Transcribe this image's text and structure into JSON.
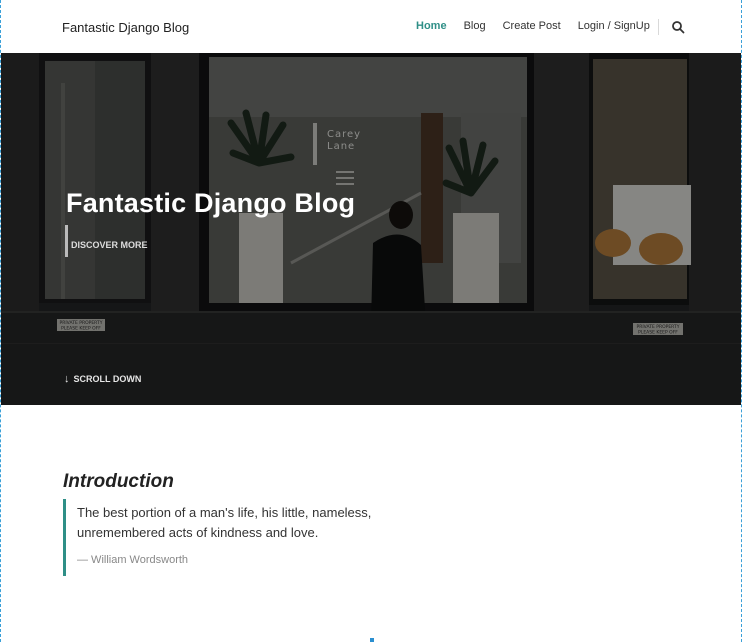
{
  "navbar": {
    "brand": "Fantastic Django Blog",
    "links": [
      {
        "label": "Home",
        "active": true
      },
      {
        "label": "Blog",
        "active": false
      },
      {
        "label": "Create Post",
        "active": false
      },
      {
        "label": "Login / SignUp",
        "active": false
      }
    ],
    "search_icon": "search-icon",
    "accent_color": "#2f8f87"
  },
  "hero": {
    "title": "Fantastic Django Blog",
    "discover_label": "DISCOVER MORE",
    "scroll_label": "SCROLL DOWN",
    "sign_line1": "Carey",
    "sign_line2": "Lane",
    "plaque_left_1": "PRIVATE PROPERTY",
    "plaque_left_2": "PLEASE KEEP OFF",
    "plaque_right_1": "PRIVATE PROPERTY",
    "plaque_right_2": "PLEASE KEEP OFF"
  },
  "intro": {
    "heading": "Introduction",
    "quote": "The best portion of a man's life, his little, nameless, unremembered acts of kindness and love.",
    "author": "— William Wordsworth"
  }
}
